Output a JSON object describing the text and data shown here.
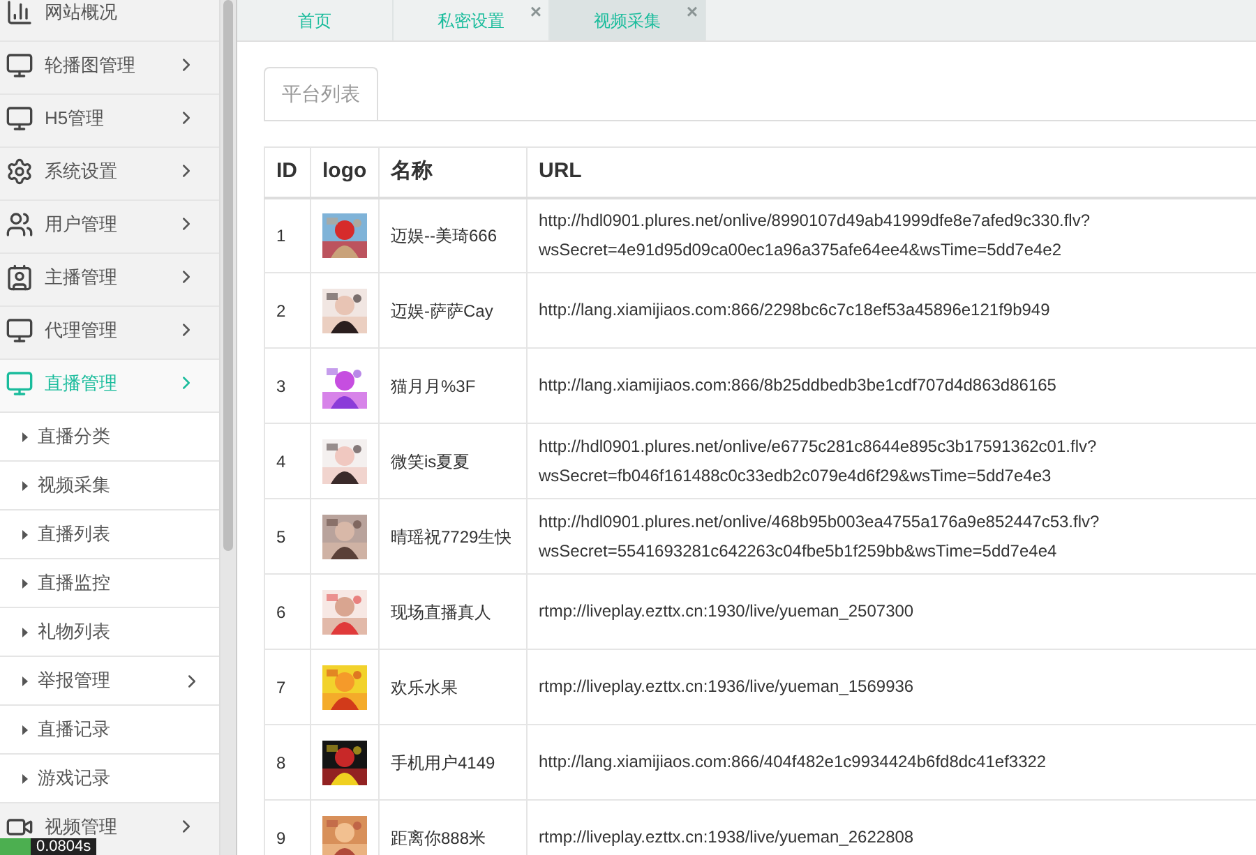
{
  "sidebar": {
    "items": [
      {
        "label": "网站概况",
        "selected": false,
        "has_submenu": false
      },
      {
        "label": "轮播图管理",
        "selected": false,
        "has_submenu": true
      },
      {
        "label": "H5管理",
        "selected": false,
        "has_submenu": true
      },
      {
        "label": "系统设置",
        "selected": false,
        "has_submenu": true
      },
      {
        "label": "用户管理",
        "selected": false,
        "has_submenu": true
      },
      {
        "label": "主播管理",
        "selected": false,
        "has_submenu": true
      },
      {
        "label": "代理管理",
        "selected": false,
        "has_submenu": true
      },
      {
        "label": "直播管理",
        "selected": true,
        "has_submenu": true,
        "expanded": true,
        "children": [
          {
            "label": "直播分类",
            "selected": false,
            "has_submenu": false
          },
          {
            "label": "视频采集",
            "selected": false,
            "has_submenu": false
          },
          {
            "label": "直播列表",
            "selected": false,
            "has_submenu": false
          },
          {
            "label": "直播监控",
            "selected": false,
            "has_submenu": false
          },
          {
            "label": "礼物列表",
            "selected": false,
            "has_submenu": false
          },
          {
            "label": "举报管理",
            "selected": false,
            "has_submenu": true
          },
          {
            "label": "直播记录",
            "selected": false,
            "has_submenu": false
          },
          {
            "label": "游戏记录",
            "selected": false,
            "has_submenu": false
          }
        ]
      },
      {
        "label": "视频管理",
        "selected": false,
        "has_submenu": true
      }
    ]
  },
  "debug_timer": "0.0804s",
  "tabs": [
    {
      "label": "首页",
      "selected": false,
      "closable": false
    },
    {
      "label": "私密设置",
      "selected": false,
      "closable": true
    },
    {
      "label": "视频采集",
      "selected": true,
      "closable": true
    }
  ],
  "close_symbol": "×",
  "panel_tab": "平台列表",
  "table": {
    "columns": [
      "ID",
      "logo",
      "名称",
      "URL"
    ],
    "rows": [
      {
        "id": "1",
        "name": "迈娱--美琦666",
        "url": [
          "http://hdl0901.plures.net/onlive/8990107d49ab41999dfe8e7afed9c330.flv?",
          "wsSecret=4e91d95d09ca00ec1a96a375afe64ee4&wsTime=5dd7e4e2"
        ]
      },
      {
        "id": "2",
        "name": "迈娱-萨萨Cay",
        "url": [
          "http://lang.xiamijiaos.com:866/2298bc6c7c18ef53a45896e121f9b949"
        ]
      },
      {
        "id": "3",
        "name": "猫月月%3F",
        "url": [
          "http://lang.xiamijiaos.com:866/8b25ddbedb3be1cdf707d4d863d86165"
        ]
      },
      {
        "id": "4",
        "name": "微笑is夏夏",
        "url": [
          "http://hdl0901.plures.net/onlive/e6775c281c8644e895c3b17591362c01.flv?",
          "wsSecret=fb046f161488c0c33edb2c079e4d6f29&wsTime=5dd7e4e3"
        ]
      },
      {
        "id": "5",
        "name": "晴瑶祝7729生快",
        "url": [
          "http://hdl0901.plures.net/onlive/468b95b003ea4755a176a9e852447c53.flv?",
          "wsSecret=5541693281c642263c04fbe5b1f259bb&wsTime=5dd7e4e4"
        ]
      },
      {
        "id": "6",
        "name": "现场直播真人",
        "url": [
          "rtmp://liveplay.ezttx.cn:1930/live/yueman_2507300"
        ]
      },
      {
        "id": "7",
        "name": "欢乐水果",
        "url": [
          "rtmp://liveplay.ezttx.cn:1936/live/yueman_1569936"
        ]
      },
      {
        "id": "8",
        "name": "手机用户4149",
        "url": [
          "http://lang.xiamijiaos.com:866/404f482e1c9934424b6fd8dc41ef3322"
        ]
      },
      {
        "id": "9",
        "name": "距离你888米",
        "url": [
          "rtmp://liveplay.ezttx.cn:1938/live/yueman_2622808"
        ]
      }
    ]
  }
}
